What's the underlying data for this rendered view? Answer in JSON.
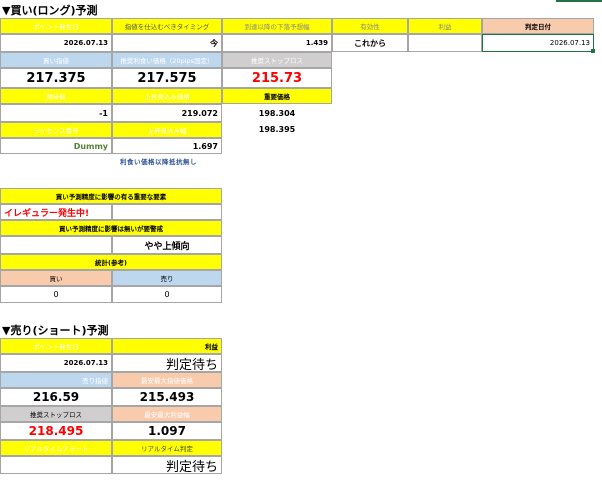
{
  "long": {
    "title": "▼買い(ロング)予測",
    "labels": {
      "point_date": "ポイント発生日",
      "timing": "指値を仕込むべきタイミング",
      "lower_target": "到達以降の下落予想幅",
      "valid": "有効性",
      "profit": "利益",
      "judge_date": "判定日付",
      "buy_limit": "買い指値",
      "recommended_buy": "推奨利食い価格（20pips固定）",
      "stop_loss": "推奨ストップロス",
      "expected": "期待値",
      "upper_target_price": "上昇見込み価格",
      "key_price": "重要価格",
      "license": "ライセンス番号",
      "upper_target_width": "上昇見込み幅"
    },
    "values": {
      "point_date": "2026.07.13",
      "timing": "今",
      "lower_target": "1.439",
      "valid": "これから",
      "profit": "",
      "judge_date": "2026.07.13",
      "buy_limit": "217.375",
      "recommended_buy": "217.575",
      "stop_loss": "215.73",
      "expected": "-1",
      "upper_target_price": "219.072",
      "key_price_1": "198.304",
      "key_price_2": "198.395",
      "license": "Dummy",
      "upper_target_width": "1.697"
    },
    "note": "利食い価格以降抵抗無し"
  },
  "mid": {
    "irregular_header": "買い予測精度に影響の有る重要な要素",
    "irregular_value": "イレギュラー発生中!",
    "trend_header": "買い予測精度に影響は無いが要警戒",
    "trend_value": "やや上傾向",
    "stats_header": "統計(参考)",
    "buy_label": "買い",
    "sell_label": "売り",
    "buy_value": "0",
    "sell_value": "0"
  },
  "short": {
    "title": "▼売り(ショート)予測",
    "labels": {
      "point_date": "ポイント発生日",
      "profit": "利益",
      "sell_limit": "売り指値",
      "max_limit": "最安最大指値価格",
      "stop_loss": "推奨ストップロス",
      "max_profit": "最安最大利益幅",
      "alert": "リアルタイムアラート",
      "realtime": "リアルタイム判定"
    },
    "values": {
      "point_date": "2026.07.13",
      "profit": "判定待ち",
      "sell_limit": "216.59",
      "max_limit": "215.493",
      "stop_loss": "218.495",
      "max_profit": "1.097",
      "alert": "",
      "realtime": "判定待ち"
    }
  },
  "colors": {
    "yellow": "#ffff00",
    "blue": "#bdd7ee",
    "gray": "#d0cece",
    "orange": "#f8cbad",
    "red": "#ff0000",
    "green": "#548235"
  }
}
